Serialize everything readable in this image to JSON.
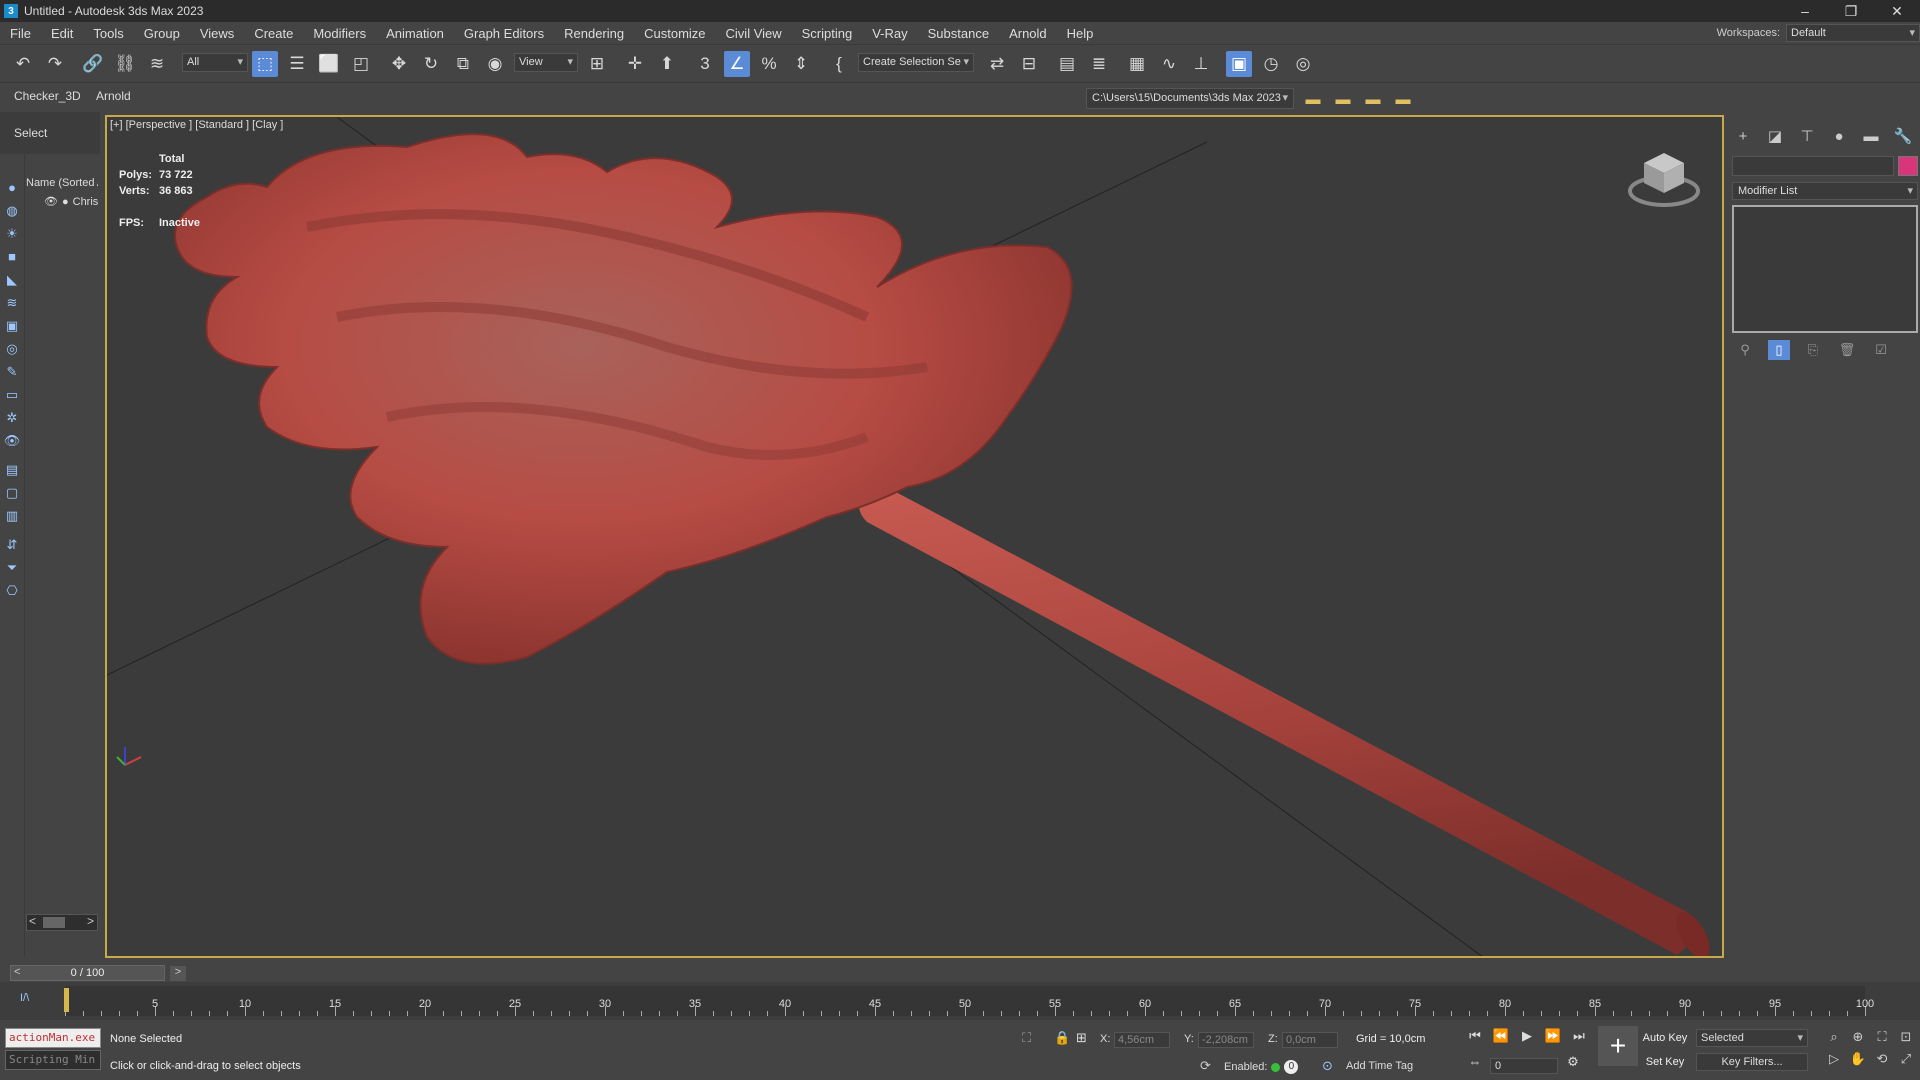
{
  "window": {
    "title": "Untitled - Autodesk 3ds Max 2023",
    "controls": [
      "–",
      "❐",
      "✕"
    ]
  },
  "menubar": {
    "items": [
      "File",
      "Edit",
      "Tools",
      "Group",
      "Views",
      "Create",
      "Modifiers",
      "Animation",
      "Graph Editors",
      "Rendering",
      "Customize",
      "Civil View",
      "Scripting",
      "V-Ray",
      "Substance",
      "Arnold",
      "Help"
    ]
  },
  "workspaces": {
    "label": "Workspaces:",
    "value": "Default"
  },
  "toolbar": {
    "filter_value": "All",
    "refcoord_value": "View",
    "selection_set_value": "Create Selection Se"
  },
  "ribbon2": {
    "tabs": [
      "Checker_3D",
      "Arnold"
    ],
    "project_path": "C:\\Users\\15\\Documents\\3ds Max 2023"
  },
  "scene_explorer": {
    "select_tab": "Select",
    "column_header": "Name (Sorted A",
    "rows": [
      "Chris"
    ]
  },
  "viewport": {
    "label": "[+] [Perspective ] [Standard ] [Clay ]",
    "stats": {
      "total_label": "Total",
      "polys_label": "Polys:",
      "polys_value": "73 722",
      "verts_label": "Verts:",
      "verts_value": "36 863",
      "fps_label": "FPS:",
      "fps_value": "Inactive"
    },
    "object_color": "#b04a42"
  },
  "command_panel": {
    "modifier_list": "Modifier List",
    "object_color": "#d9357a"
  },
  "timeline": {
    "slider_label": "0 / 100",
    "prev": "<",
    "next": ">",
    "tick_labels": [
      "0",
      "5",
      "10",
      "15",
      "20",
      "25",
      "30",
      "35",
      "40",
      "45",
      "50",
      "55",
      "60",
      "65",
      "70",
      "75",
      "80",
      "85",
      "90",
      "95",
      "100"
    ]
  },
  "status": {
    "script_line1": "actionMan.exe",
    "script_line2": "Scripting Min",
    "selection": "None Selected",
    "prompt": "Click or click-and-drag to select objects",
    "x_label": "X:",
    "x_value": "4,56cm",
    "y_label": "Y:",
    "y_value": "-2,208cm",
    "z_label": "Z:",
    "z_value": "0,0cm",
    "grid": "Grid = 10,0cm",
    "enabled_label": "Enabled:",
    "enabled_value": "0",
    "add_time_tag": "Add Time Tag",
    "auto_key": "Auto Key",
    "set_key": "Set Key",
    "selected_value": "Selected",
    "key_filters": "Key Filters...",
    "frame_value": "0"
  }
}
